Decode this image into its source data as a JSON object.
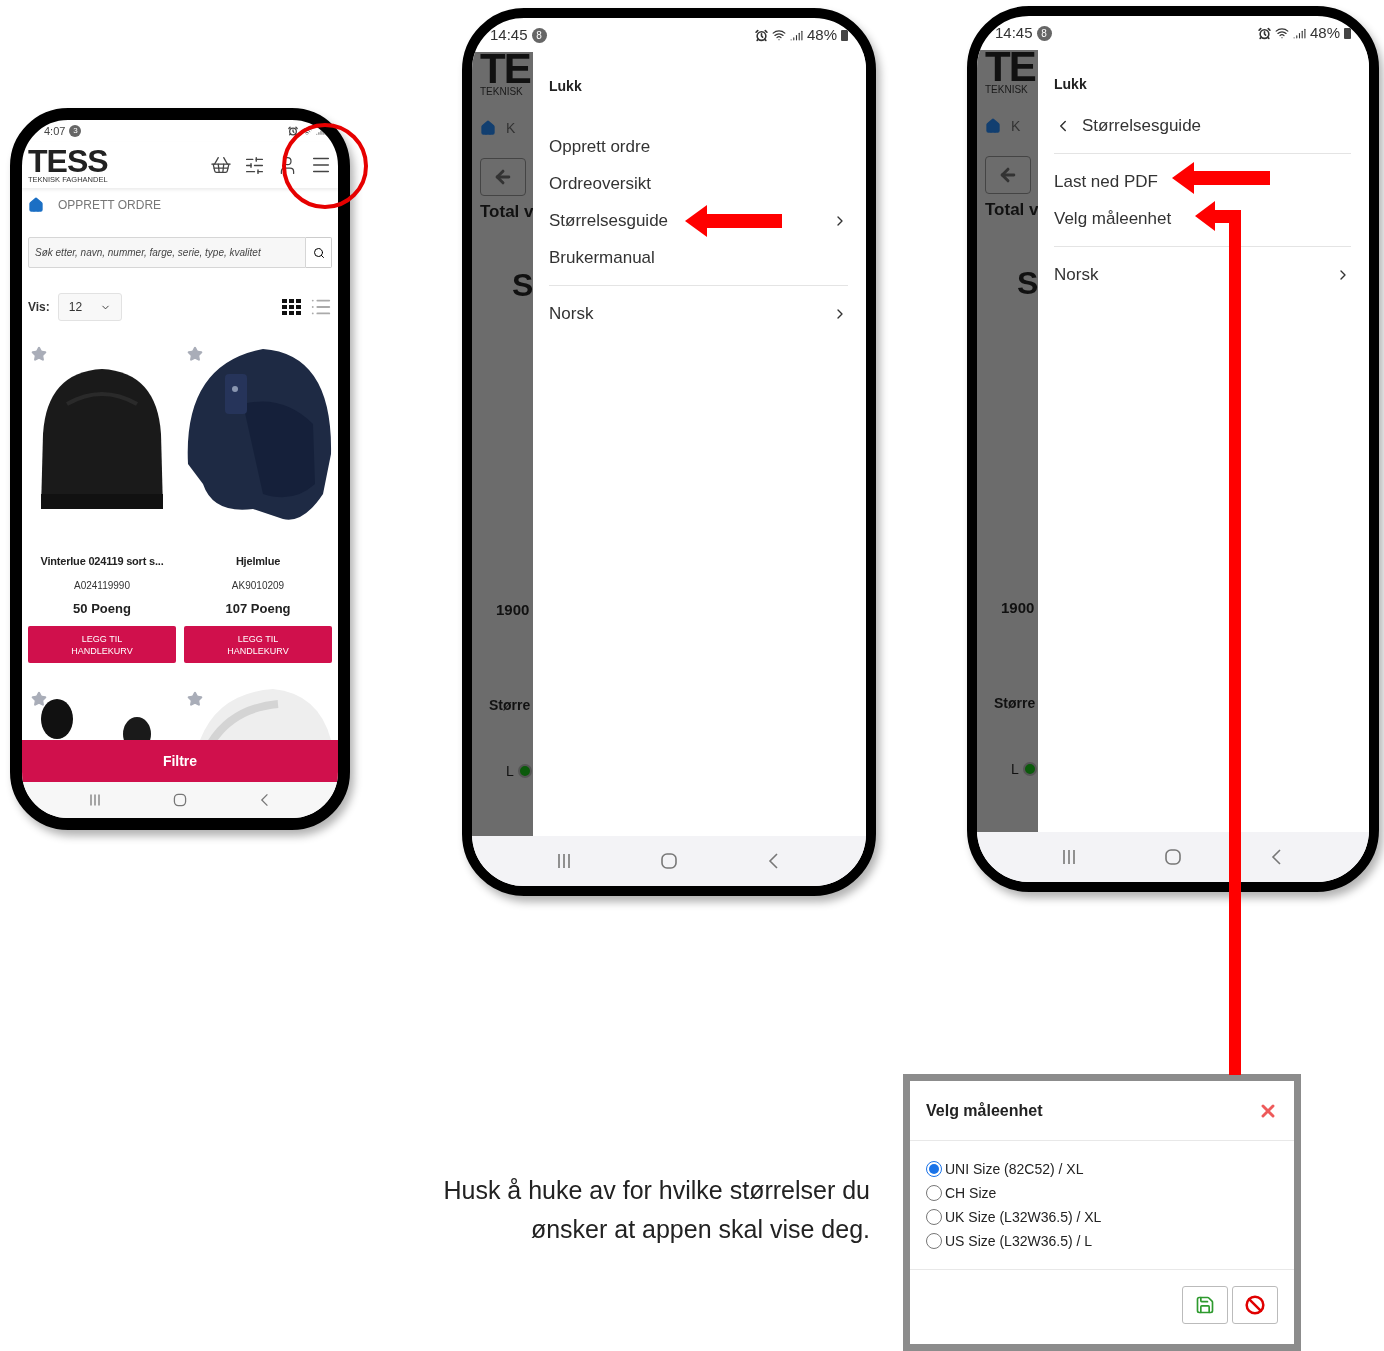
{
  "phones": [
    {
      "kind": "catalog",
      "status": {
        "time": "4:07",
        "badge": "3"
      },
      "header": {
        "logo": "TESS",
        "tagline": "TEKNISK FAGHANDEL"
      },
      "breadcrumb": "OPPRETT ORDRE",
      "search": {
        "placeholder": "Søk etter, navn, nummer, farge, serie, type, kvalitet"
      },
      "view": {
        "label": "Vis:",
        "value": "12"
      },
      "products": [
        {
          "kind": "card",
          "favorite": false,
          "name": "Vinterlue 024119 sort s...",
          "code": "A024119990",
          "points": "50 Poeng",
          "button": "LEGG TIL HANDLEKURV"
        },
        {
          "kind": "card",
          "favorite": false,
          "name": "Hjelmlue",
          "code": "AK9010209",
          "points": "107 Poeng",
          "button": "LEGG TIL HANDLEKURV"
        },
        {
          "kind": "partial",
          "favorite": false
        },
        {
          "kind": "partial",
          "favorite": false
        }
      ],
      "filter_button": "Filtre"
    },
    {
      "kind": "menu",
      "status": {
        "time": "14:45",
        "badge": "8",
        "battery": "48%"
      },
      "background": {
        "logo": "TE",
        "tagline": "TEKNISK",
        "crumb": "K",
        "total": "Total v",
        "heading": "S",
        "amount": "1900",
        "section": "Større",
        "size": "L"
      },
      "drawer": {
        "close": "Lukk",
        "groups": [
          [
            {
              "label": "Opprett ordre",
              "kind": "link"
            },
            {
              "label": "Ordreoversikt",
              "kind": "link"
            },
            {
              "label": "Størrelsesguide",
              "kind": "submenu"
            },
            {
              "label": "Brukermanual",
              "kind": "link"
            }
          ],
          [
            {
              "label": "Norsk",
              "kind": "submenu"
            }
          ]
        ]
      }
    },
    {
      "kind": "menu",
      "status": {
        "time": "14:45",
        "badge": "8",
        "battery": "48%"
      },
      "background": {
        "logo": "TE",
        "tagline": "TEKNISK",
        "crumb": "K",
        "total": "Total v",
        "heading": "S",
        "amount": "1900",
        "section": "Større",
        "size": "L"
      },
      "drawer": {
        "close": "Lukk",
        "groups": [
          [
            {
              "label": "Størrelsesguide",
              "kind": "back"
            }
          ],
          [
            {
              "label": "Last ned PDF",
              "kind": "link"
            },
            {
              "label": "Velg måleenhet",
              "kind": "link"
            }
          ],
          [
            {
              "label": "Norsk",
              "kind": "submenu"
            }
          ]
        ]
      }
    }
  ],
  "caption": "Husk å huke av for hvilke størrelser du ønsker at appen skal vise deg.",
  "dialog": {
    "title": "Velg måleenhet",
    "options": [
      {
        "label": "UNI Size (82C52) / XL",
        "selected": true
      },
      {
        "label": "CH Size",
        "selected": false
      },
      {
        "label": "UK Size (L32W36.5) / XL",
        "selected": false
      },
      {
        "label": "US Size (L32W36.5) / L",
        "selected": false
      }
    ]
  }
}
